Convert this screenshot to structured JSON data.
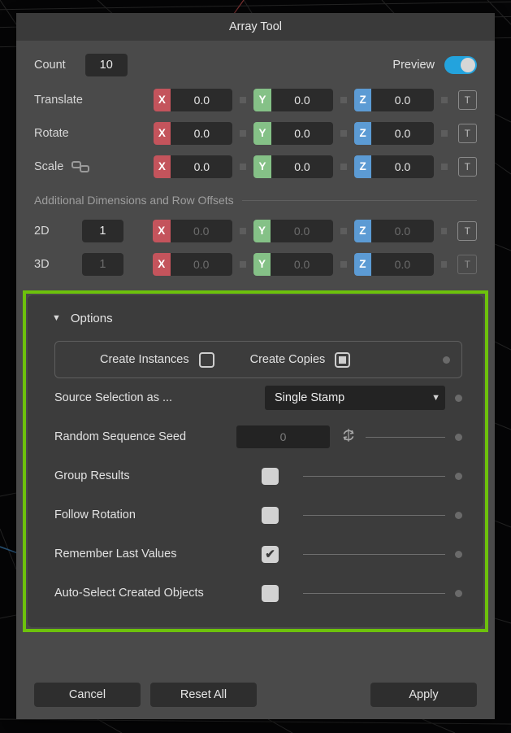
{
  "window": {
    "title": "Array Tool"
  },
  "count": {
    "label": "Count",
    "value": "10"
  },
  "preview": {
    "label": "Preview",
    "state": "on"
  },
  "transform_rows": [
    {
      "name": "Translate",
      "x": "0.0",
      "y": "0.0",
      "z": "0.0",
      "t_label": "T",
      "enabled": true
    },
    {
      "name": "Rotate",
      "x": "0.0",
      "y": "0.0",
      "z": "0.0",
      "t_label": "T",
      "enabled": true
    },
    {
      "name": "Scale",
      "x": "0.0",
      "y": "0.0",
      "z": "0.0",
      "t_label": "T",
      "enabled": true,
      "icon": "chain-link-icon"
    }
  ],
  "section": {
    "label": "Additional Dimensions and Row Offsets"
  },
  "dimension_rows": [
    {
      "name": "2D",
      "count": "1",
      "x": "0.0",
      "y": "0.0",
      "z": "0.0",
      "t_label": "T",
      "enabled": true
    },
    {
      "name": "3D",
      "count": "1",
      "x": "0.0",
      "y": "0.0",
      "z": "0.0",
      "t_label": "T",
      "enabled": false
    }
  ],
  "options": {
    "header": "Options",
    "caret": "▼",
    "mode": {
      "instances_label": "Create Instances",
      "instances_selected": false,
      "copies_label": "Create Copies",
      "copies_selected": true
    },
    "source_selection": {
      "label": "Source Selection as ...",
      "value": "Single Stamp",
      "arrow": "▼"
    },
    "random_seed": {
      "label": "Random Sequence Seed",
      "value": "0"
    },
    "checkboxes": [
      {
        "label": "Group Results",
        "checked": false
      },
      {
        "label": "Follow Rotation",
        "checked": false
      },
      {
        "label": "Remember Last Values",
        "checked": true
      },
      {
        "label": "Auto-Select Created Objects",
        "checked": false
      }
    ],
    "check_glyph": "✔"
  },
  "footer": {
    "cancel": "Cancel",
    "reset": "Reset All",
    "apply": "Apply"
  },
  "colors": {
    "axis_x": "#c4545c",
    "axis_y": "#85c187",
    "axis_z": "#5c9bd4",
    "highlight": "#6dc20c",
    "toggle_on": "#23a3dd",
    "dialog_bg": "#4a4a4a",
    "panel_bg": "#3c3c3c",
    "field_bg": "#2b2b2b"
  },
  "axis_labels": {
    "x": "X",
    "y": "Y",
    "z": "Z"
  }
}
